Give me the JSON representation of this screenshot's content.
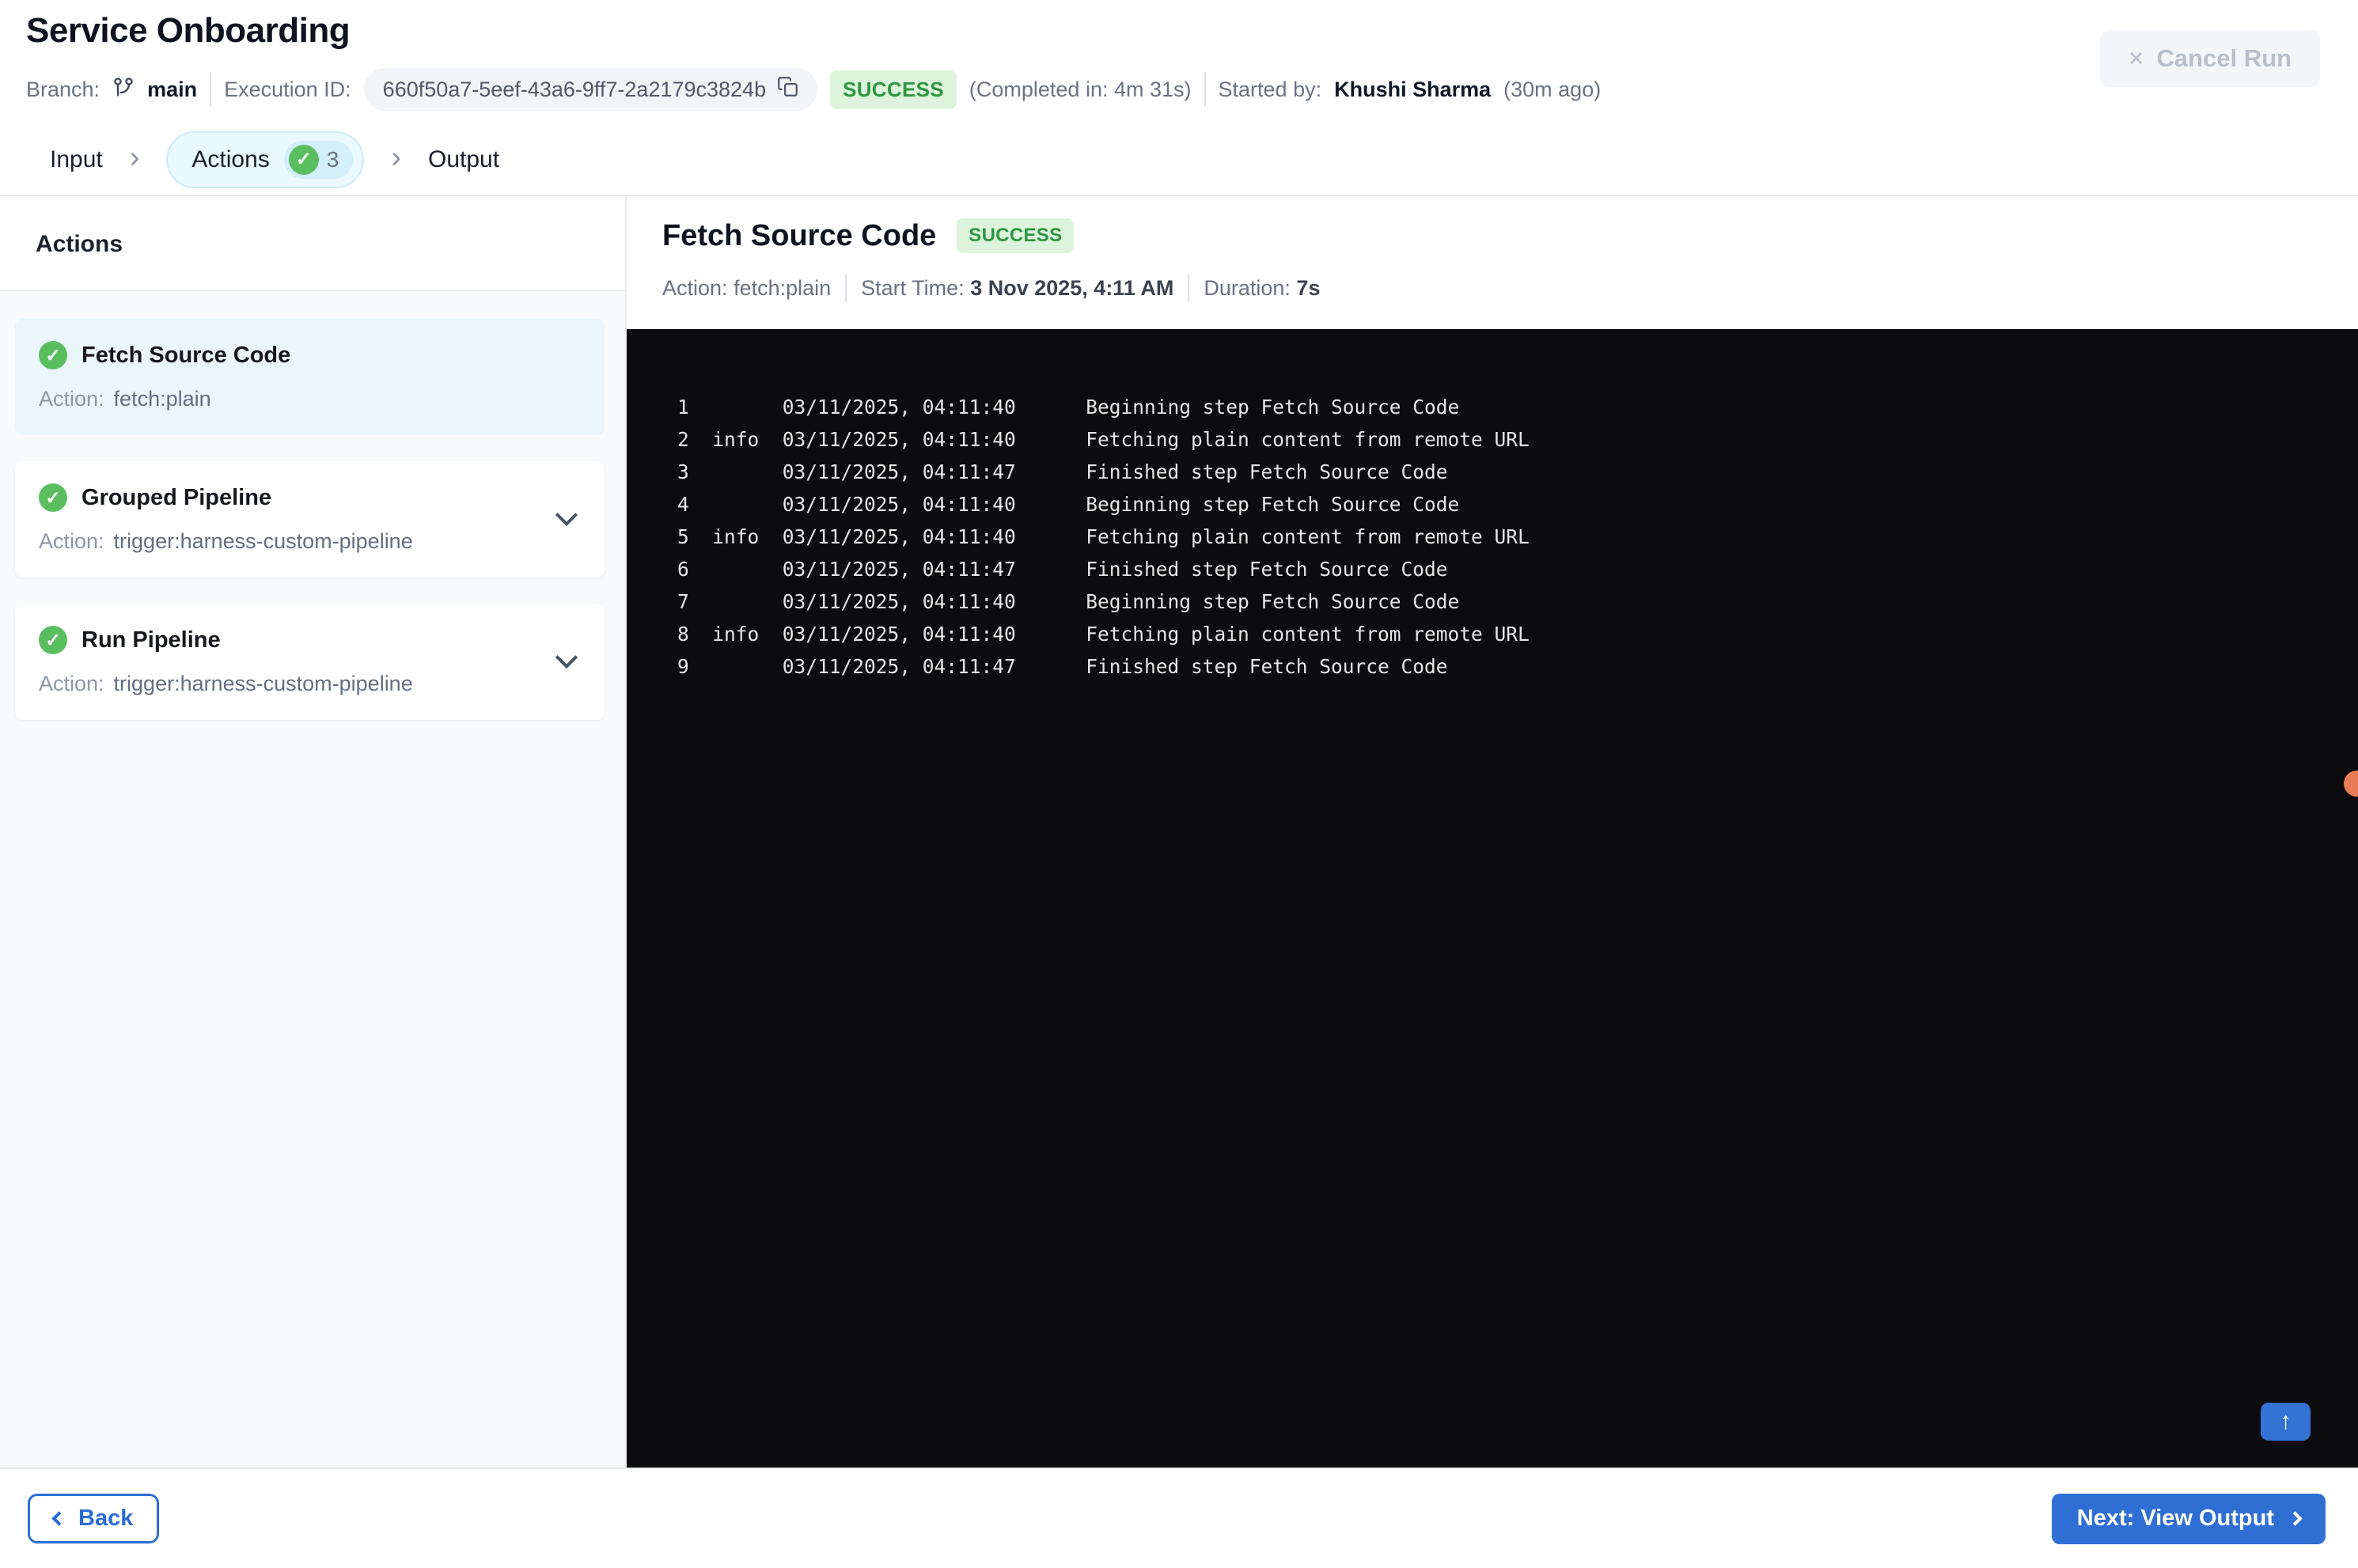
{
  "header": {
    "title": "Service Onboarding",
    "branch_label": "Branch:",
    "branch_name": "main",
    "execution_id_label": "Execution ID:",
    "execution_id": "660f50a7-5eef-43a6-9ff7-2a2179c3824b",
    "status": "SUCCESS",
    "completed_in": "(Completed in: 4m 31s)",
    "started_by_label": "Started by:",
    "started_by": "Khushi Sharma",
    "started_ago": "(30m ago)",
    "cancel_button": "Cancel Run"
  },
  "stepper": {
    "tabs": [
      {
        "label": "Input",
        "active": false
      },
      {
        "label": "Actions",
        "active": true,
        "count": "3"
      },
      {
        "label": "Output",
        "active": false
      }
    ]
  },
  "sidebar": {
    "heading": "Actions",
    "action_label": "Action:",
    "items": [
      {
        "title": "Fetch Source Code",
        "action": "fetch:plain",
        "status": "success",
        "selected": true,
        "expandable": false
      },
      {
        "title": "Grouped Pipeline",
        "action": "trigger:harness-custom-pipeline",
        "status": "success",
        "selected": false,
        "expandable": true
      },
      {
        "title": "Run Pipeline",
        "action": "trigger:harness-custom-pipeline",
        "status": "success",
        "selected": false,
        "expandable": true
      }
    ]
  },
  "detail": {
    "title": "Fetch Source Code",
    "status": "SUCCESS",
    "action_label": "Action:",
    "action_value": "fetch:plain",
    "start_time_label": "Start Time:",
    "start_time_value": "3 Nov 2025, 4:11 AM",
    "duration_label": "Duration:",
    "duration_value": "7s"
  },
  "console": {
    "lines": [
      {
        "n": "1",
        "level": "",
        "ts": "03/11/2025, 04:11:40",
        "msg": "Beginning step Fetch Source Code"
      },
      {
        "n": "2",
        "level": "info",
        "ts": "03/11/2025, 04:11:40",
        "msg": "Fetching plain content from remote URL"
      },
      {
        "n": "3",
        "level": "",
        "ts": "03/11/2025, 04:11:47",
        "msg": "Finished step Fetch Source Code"
      },
      {
        "n": "4",
        "level": "",
        "ts": "03/11/2025, 04:11:40",
        "msg": "Beginning step Fetch Source Code"
      },
      {
        "n": "5",
        "level": "info",
        "ts": "03/11/2025, 04:11:40",
        "msg": "Fetching plain content from remote URL"
      },
      {
        "n": "6",
        "level": "",
        "ts": "03/11/2025, 04:11:47",
        "msg": "Finished step Fetch Source Code"
      },
      {
        "n": "7",
        "level": "",
        "ts": "03/11/2025, 04:11:40",
        "msg": "Beginning step Fetch Source Code"
      },
      {
        "n": "8",
        "level": "info",
        "ts": "03/11/2025, 04:11:40",
        "msg": "Fetching plain content from remote URL"
      },
      {
        "n": "9",
        "level": "",
        "ts": "03/11/2025, 04:11:47",
        "msg": "Finished step Fetch Source Code"
      }
    ]
  },
  "footer": {
    "back_button": "Back",
    "next_button": "Next: View Output"
  },
  "colors": {
    "accent_blue": "#2f6fd3",
    "success_green": "#5abe5e",
    "success_badge_bg": "#dcf3dc",
    "success_badge_text": "#2e9640",
    "sidebar_bg": "#f8fafc",
    "selected_card_bg": "#eaf6fb",
    "console_bg": "#0c0c0e",
    "orange_dot": "#e97c55"
  }
}
